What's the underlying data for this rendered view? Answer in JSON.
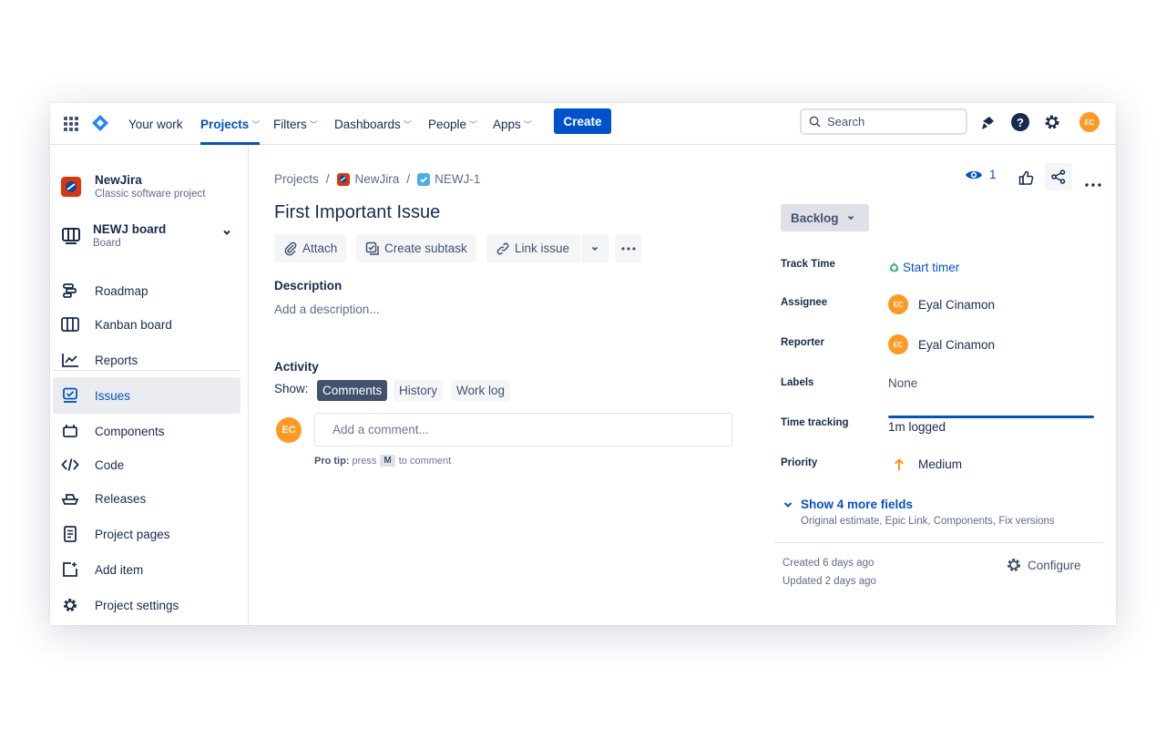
{
  "nav": {
    "your_work": "Your work",
    "projects": "Projects",
    "filters": "Filters",
    "dashboards": "Dashboards",
    "people": "People",
    "apps": "Apps",
    "create": "Create",
    "search_placeholder": "Search",
    "avatar_initials": "EC",
    "chevron": "⌄"
  },
  "sidebar": {
    "project_name": "NewJira",
    "project_type": "Classic software project",
    "board_name": "NEWJ board",
    "board_sub": "Board",
    "items": [
      {
        "label": "Roadmap",
        "icon": "roadmap-icon"
      },
      {
        "label": "Kanban board",
        "icon": "kanban-icon"
      },
      {
        "label": "Reports",
        "icon": "reports-icon"
      },
      {
        "label": "Issues",
        "icon": "issues-icon",
        "selected": true
      },
      {
        "label": "Components",
        "icon": "components-icon"
      },
      {
        "label": "Code",
        "icon": "code-icon"
      },
      {
        "label": "Releases",
        "icon": "releases-icon"
      },
      {
        "label": "Project pages",
        "icon": "pages-icon"
      },
      {
        "label": "Add item",
        "icon": "add-item-icon"
      },
      {
        "label": "Project settings",
        "icon": "settings-icon"
      }
    ]
  },
  "issue": {
    "breadcrumb": [
      "Projects",
      "NewJira",
      "NEWJ-1"
    ],
    "title": "First Important Issue",
    "toolbar": {
      "attach": "Attach",
      "create_subtask": "Create subtask",
      "link_issue": "Link issue"
    },
    "description_heading": "Description",
    "description_placeholder": "Add a description...",
    "activity_heading": "Activity",
    "show_label": "Show:",
    "tabs": [
      "Comments",
      "History",
      "Work log"
    ],
    "comment_placeholder": "Add a comment...",
    "pro_tip_bold": "Pro tip:",
    "pro_tip_press": "press",
    "pro_tip_key": "M",
    "pro_tip_rest": "to comment"
  },
  "details": {
    "watchers": "1",
    "status": "Backlog",
    "fields": {
      "track_time_label": "Track Time",
      "track_time_value": "Start timer",
      "assignee_label": "Assignee",
      "assignee_value": "Eyal Cinamon",
      "reporter_label": "Reporter",
      "reporter_value": "Eyal Cinamon",
      "labels_label": "Labels",
      "labels_value": "None",
      "time_tracking_label": "Time tracking",
      "time_tracking_value": "1m logged",
      "priority_label": "Priority",
      "priority_value": "Medium"
    },
    "show_more": "Show 4 more fields",
    "show_more_sub": "Original estimate, Epic Link, Components, Fix versions",
    "created": "Created 6 days ago",
    "updated": "Updated 2 days ago",
    "configure": "Configure"
  },
  "colors": {
    "accent": "#0052cc",
    "avatar": "#ff991f",
    "priority_medium": "#ff8b00",
    "timer_green": "#36b37e"
  }
}
